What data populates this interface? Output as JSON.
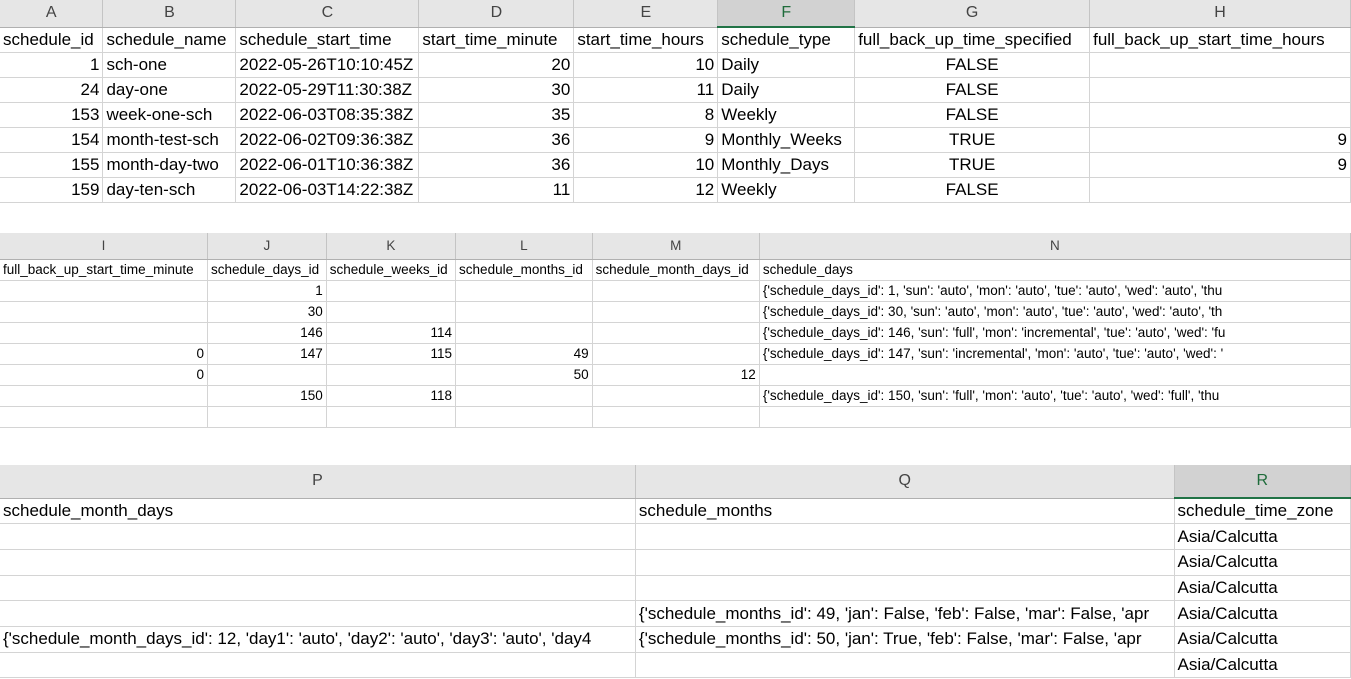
{
  "panel1": {
    "columns": [
      "A",
      "B",
      "C",
      "D",
      "E",
      "F",
      "G",
      "H"
    ],
    "rows": [
      [
        "schedule_id",
        "schedule_name",
        "schedule_start_time",
        "start_time_minute",
        "start_time_hours",
        "schedule_type",
        "full_back_up_time_specified",
        "full_back_up_start_time_hours"
      ],
      [
        "1",
        "sch-one",
        "2022-05-26T10:10:45Z",
        "20",
        "10",
        "Daily",
        "FALSE",
        ""
      ],
      [
        "24",
        "day-one",
        "2022-05-29T11:30:38Z",
        "30",
        "11",
        "Daily",
        "FALSE",
        ""
      ],
      [
        "153",
        "week-one-sch",
        "2022-06-03T08:35:38Z",
        "35",
        "8",
        "Weekly",
        "FALSE",
        ""
      ],
      [
        "154",
        "month-test-sch",
        "2022-06-02T09:36:38Z",
        "36",
        "9",
        "Monthly_Weeks",
        "TRUE",
        "9"
      ],
      [
        "155",
        "month-day-two",
        "2022-06-01T10:36:38Z",
        "36",
        "10",
        "Monthly_Days",
        "TRUE",
        "9"
      ],
      [
        "159",
        "day-ten-sch",
        "2022-06-03T14:22:38Z",
        "11",
        "12",
        "Weekly",
        "FALSE",
        ""
      ]
    ]
  },
  "panel2": {
    "columns": [
      "I",
      "J",
      "K",
      "L",
      "M",
      "N"
    ],
    "rows": [
      [
        "full_back_up_start_time_minute",
        "schedule_days_id",
        "schedule_weeks_id",
        "schedule_months_id",
        "schedule_month_days_id",
        "schedule_days"
      ],
      [
        "",
        "1",
        "",
        "",
        "",
        "{'schedule_days_id': 1, 'sun': 'auto', 'mon': 'auto', 'tue': 'auto', 'wed': 'auto', 'thu"
      ],
      [
        "",
        "30",
        "",
        "",
        "",
        "{'schedule_days_id': 30, 'sun': 'auto', 'mon': 'auto', 'tue': 'auto', 'wed': 'auto', 'th"
      ],
      [
        "",
        "146",
        "114",
        "",
        "",
        "{'schedule_days_id': 146, 'sun': 'full', 'mon': 'incremental', 'tue': 'auto', 'wed': 'fu"
      ],
      [
        "0",
        "147",
        "115",
        "49",
        "",
        "{'schedule_days_id': 147, 'sun': 'incremental', 'mon': 'auto', 'tue': 'auto', 'wed': '"
      ],
      [
        "0",
        "",
        "",
        "50",
        "12",
        ""
      ],
      [
        "",
        "150",
        "118",
        "",
        "",
        "{'schedule_days_id': 150, 'sun': 'full', 'mon': 'auto', 'tue': 'auto', 'wed': 'full', 'thu"
      ],
      [
        "",
        "",
        "",
        "",
        "",
        ""
      ]
    ]
  },
  "panel3": {
    "columns": [
      "P",
      "Q",
      "R"
    ],
    "rows": [
      [
        "schedule_month_days",
        "schedule_months",
        "schedule_time_zone"
      ],
      [
        "",
        "",
        "Asia/Calcutta"
      ],
      [
        "",
        "",
        "Asia/Calcutta"
      ],
      [
        "",
        "",
        "Asia/Calcutta"
      ],
      [
        "",
        "{'schedule_months_id': 49, 'jan': False, 'feb': False, 'mar': False, 'apr",
        "Asia/Calcutta"
      ],
      [
        "{'schedule_month_days_id': 12, 'day1': 'auto', 'day2': 'auto', 'day3': 'auto', 'day4",
        "{'schedule_months_id': 50, 'jan': True, 'feb': False, 'mar': False, 'apr",
        "Asia/Calcutta"
      ],
      [
        "",
        "",
        "Asia/Calcutta"
      ]
    ]
  }
}
